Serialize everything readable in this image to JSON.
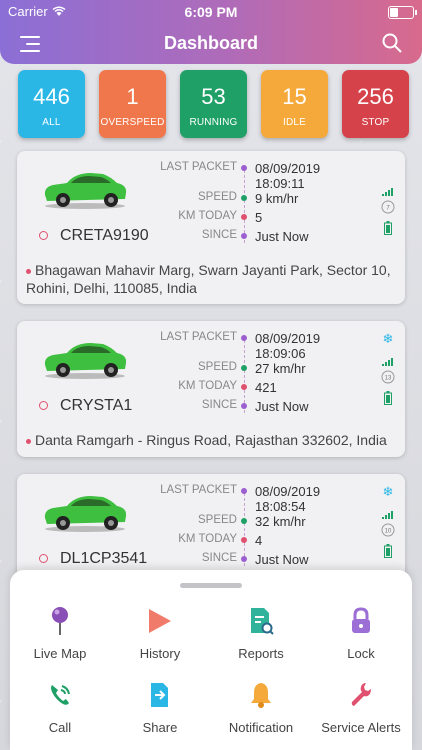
{
  "status_bar": {
    "carrier": "Carrier",
    "time": "6:09 PM"
  },
  "header": {
    "title": "Dashboard"
  },
  "stats": [
    {
      "value": "446",
      "label": "ALL",
      "color": "#2bb7e6"
    },
    {
      "value": "1",
      "label": "OVERSPEED",
      "color": "#f0774b"
    },
    {
      "value": "53",
      "label": "RUNNING",
      "color": "#1ea066"
    },
    {
      "value": "15",
      "label": "IDLE",
      "color": "#f5a93a"
    },
    {
      "value": "256",
      "label": "STOP",
      "color": "#d5424a"
    }
  ],
  "field_labels": {
    "last_packet": "LAST PACKET",
    "speed": "SPEED",
    "km_today": "KM TODAY",
    "since": "SINCE"
  },
  "vehicles": [
    {
      "name": "CRETA9190",
      "date": "08/09/2019",
      "time": "18:09:11",
      "speed": "9 km/hr",
      "km_today": "5",
      "since": "Just Now",
      "address": "Bhagawan Mahavir Marg, Swarn Jayanti Park, Sector 10, Rohini, Delhi, 110085, India",
      "odometer": "7"
    },
    {
      "name": "CRYSTA1",
      "date": "08/09/2019",
      "time": "18:09:06",
      "speed": "27 km/hr",
      "km_today": "421",
      "since": "Just Now",
      "address": "Danta Ramgarh - Ringus Road, Rajasthan 332602, India",
      "odometer": "13"
    },
    {
      "name": "DL1CP3541",
      "date": "08/09/2019",
      "time": "18:08:54",
      "speed": "32 km/hr",
      "km_today": "4",
      "since": "Just Now",
      "odometer": "10"
    }
  ],
  "actions": [
    {
      "label": "Live Map",
      "icon": "map-pin-icon"
    },
    {
      "label": "History",
      "icon": "play-icon"
    },
    {
      "label": "Reports",
      "icon": "report-icon"
    },
    {
      "label": "Lock",
      "icon": "lock-icon"
    },
    {
      "label": "Call",
      "icon": "phone-icon"
    },
    {
      "label": "Share",
      "icon": "share-icon"
    },
    {
      "label": "Notification",
      "icon": "bell-icon"
    },
    {
      "label": "Service Alerts",
      "icon": "wrench-icon"
    }
  ],
  "colors": {
    "accent_purple": "#9c5fd0",
    "accent_pink": "#e0506f",
    "green": "#1ea066"
  }
}
